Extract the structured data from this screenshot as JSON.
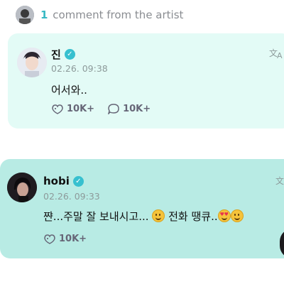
{
  "header": {
    "count": "1",
    "text": "comment from the artist"
  },
  "comments": [
    {
      "name": "진",
      "time": "02.26. 09:38",
      "body": "어서와..",
      "likes": "10K+",
      "replies": "10K+",
      "translate_icon": "translate-icon"
    },
    {
      "name": "hobi",
      "time": "02.26. 09:33",
      "body_part1": "쨘...주말 잘 보내시고...",
      "body_part2": "전화 땡큐..",
      "likes": "10K+",
      "translate_icon": "translate-icon"
    }
  ],
  "colors": {
    "accent": "#37b8c3",
    "card1_bg": "#e3fbf6",
    "card2_bg": "#b8ebe4"
  }
}
